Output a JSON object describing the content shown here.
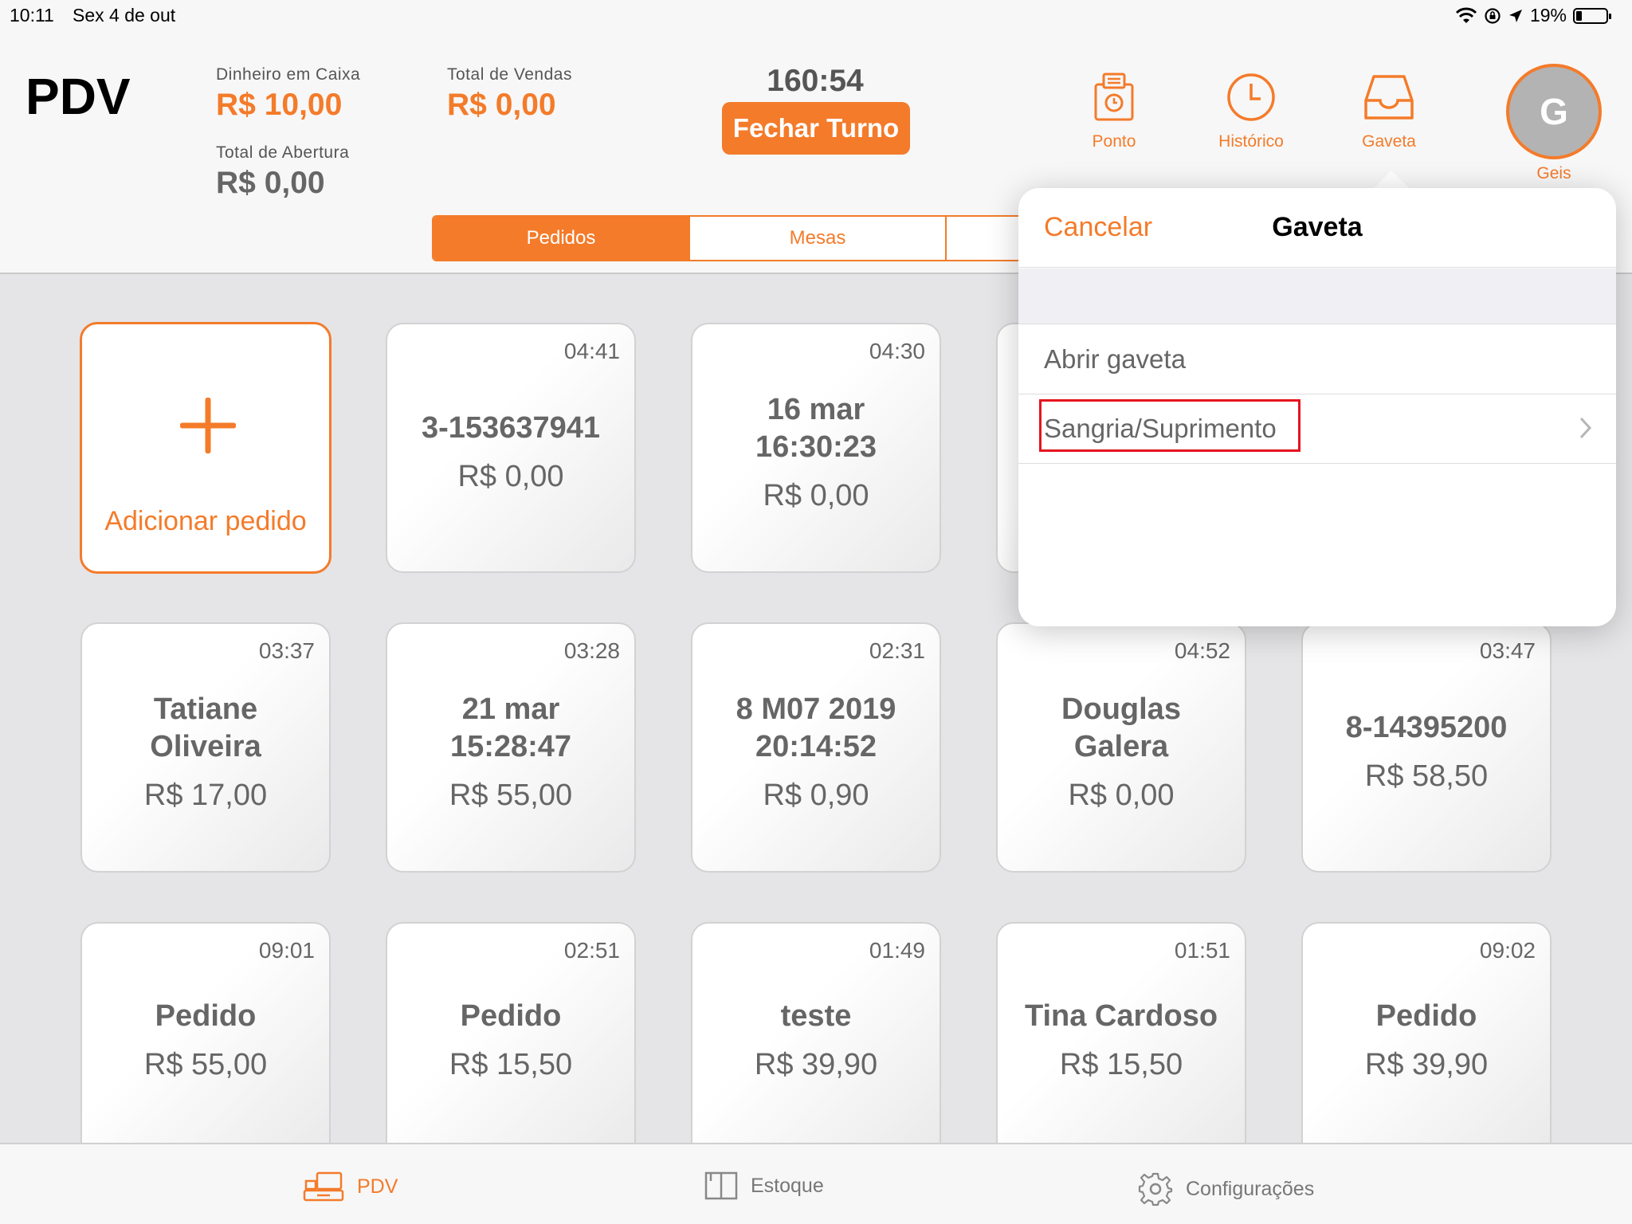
{
  "status_bar": {
    "time": "10:11",
    "date": "Sex 4 de out",
    "battery": "19%"
  },
  "header": {
    "app_title": "PDV",
    "cash": {
      "label": "Dinheiro em Caixa",
      "value": "R$ 10,00"
    },
    "sales": {
      "label": "Total de Vendas",
      "value": "R$ 0,00"
    },
    "opening": {
      "label": "Total de Abertura",
      "value": "R$ 0,00"
    },
    "timer": "160:54",
    "close_shift_label": "Fechar Turno",
    "tools": [
      {
        "label": "Ponto",
        "icon": "timeclock-icon"
      },
      {
        "label": "Histórico",
        "icon": "clock-icon"
      },
      {
        "label": "Gaveta",
        "icon": "drawer-icon"
      }
    ],
    "user": {
      "initial": "G",
      "name": "Geis"
    }
  },
  "segments": [
    {
      "label": "Pedidos",
      "active": true
    },
    {
      "label": "Mesas",
      "active": false
    },
    {
      "label": "",
      "active": false
    }
  ],
  "add_order_label": "Adicionar pedido",
  "orders": [
    {
      "time": "04:41",
      "name": "3-153637941",
      "price": "R$ 0,00",
      "name_bold": true
    },
    {
      "time": "04:30",
      "name": "16 mar 16:30:23",
      "price": "R$ 0,00"
    },
    {
      "time": "03:37",
      "name": "Tatiane Oliveira",
      "price": "R$ 17,00"
    },
    {
      "time": "03:28",
      "name": "21 mar 15:28:47",
      "price": "R$ 55,00"
    },
    {
      "time": "02:31",
      "name": "8 M07 2019 20:14:52",
      "price": "R$ 0,90"
    },
    {
      "time": "04:52",
      "name": "Douglas Galera",
      "price": "R$ 0,00"
    },
    {
      "time": "03:47",
      "name": "8-14395200",
      "price": "R$ 58,50"
    },
    {
      "time": "09:01",
      "name": "Pedido",
      "price": "R$ 55,00"
    },
    {
      "time": "02:51",
      "name": "Pedido",
      "price": "R$ 15,50"
    },
    {
      "time": "01:49",
      "name": "teste",
      "price": "R$ 39,90"
    },
    {
      "time": "01:51",
      "name": "Tina Cardoso",
      "price": "R$ 15,50"
    },
    {
      "time": "09:02",
      "name": "Pedido",
      "price": "R$ 39,90"
    }
  ],
  "popover": {
    "cancel_label": "Cancelar",
    "title": "Gaveta",
    "rows": [
      {
        "label": "Abrir gaveta"
      },
      {
        "label": "Sangria/Suprimento"
      }
    ]
  },
  "tab_bar": {
    "items": [
      {
        "label": "PDV",
        "icon": "register-icon",
        "active": true
      },
      {
        "label": "Estoque",
        "icon": "stock-icon",
        "active": false
      },
      {
        "label": "Configurações",
        "icon": "gear-icon",
        "active": false
      }
    ]
  },
  "colors": {
    "accent": "#f47b2a",
    "highlight": "#e5141f",
    "background": "#e5e5e7"
  }
}
